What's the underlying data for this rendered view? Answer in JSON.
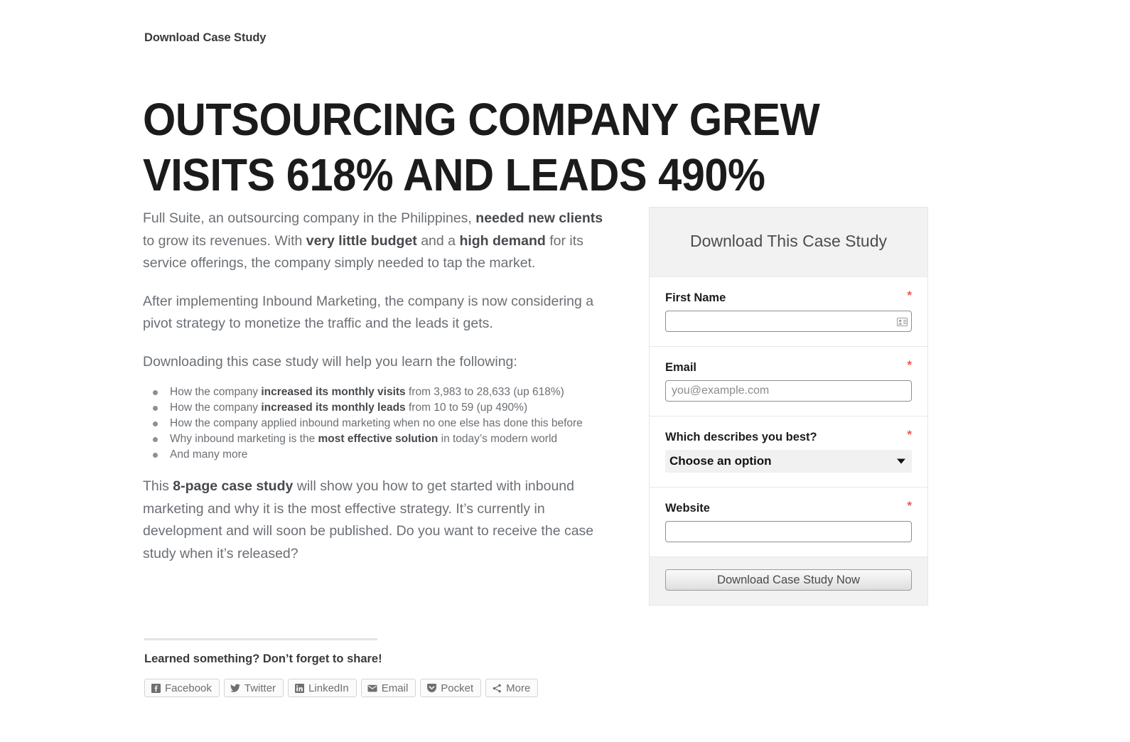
{
  "eyebrow": "Download Case Study",
  "headline": "OUTSOURCING COMPANY GREW VISITS 618% AND LEADS 490%",
  "article": {
    "paragraph1_a": "Full Suite, an outsourcing company in the Philippines, ",
    "paragraph1_b": "needed new clients",
    "paragraph1_c": " to grow its revenues. With ",
    "paragraph1_d": "very little budget",
    "paragraph1_e": " and a ",
    "paragraph1_f": "high demand",
    "paragraph1_g": " for its service offerings, the company simply needed to tap the market.",
    "paragraph2": "After implementing Inbound Marketing, the company is now considering a pivot strategy to monetize the traffic and the leads it gets.",
    "paragraph3": "Downloading this case study will help you learn the following:",
    "bullets": [
      {
        "pre": "How the company ",
        "bold": "increased its monthly visits",
        "post": " from 3,983 to 28,633 (up 618%)"
      },
      {
        "pre": "How the company ",
        "bold": "increased its monthly leads",
        "post": " from 10 to 59 (up 490%)"
      },
      {
        "pre": "How the company applied inbound marketing when no one else has done this before",
        "bold": "",
        "post": ""
      },
      {
        "pre": "Why inbound marketing is the ",
        "bold": "most effective solution",
        "post": " in today’s modern world"
      },
      {
        "pre": "And many more",
        "bold": "",
        "post": ""
      }
    ],
    "closing_a": "This ",
    "closing_b": "8-page case study",
    "closing_c": " will show you how to get started with inbound marketing and why it is the most effective strategy. It’s currently in development and will soon be published. Do you want to receive the case study when it’s released?"
  },
  "share": {
    "title": "Learned something? Don’t forget to share!",
    "buttons": [
      {
        "label": "Facebook",
        "icon": "facebook-icon"
      },
      {
        "label": "Twitter",
        "icon": "twitter-icon"
      },
      {
        "label": "LinkedIn",
        "icon": "linkedin-icon"
      },
      {
        "label": "Email",
        "icon": "envelope-icon"
      },
      {
        "label": "Pocket",
        "icon": "pocket-icon"
      },
      {
        "label": "More",
        "icon": "share-more-icon"
      }
    ]
  },
  "form": {
    "heading": "Download This Case Study",
    "required_mark": "*",
    "fields": [
      {
        "label": "First Name",
        "value": "",
        "placeholder": ""
      },
      {
        "label": "Email",
        "value": "",
        "placeholder": "you@example.com"
      },
      {
        "label": "Which describes you best?",
        "selected": "Choose an option"
      },
      {
        "label": "Website",
        "value": "",
        "placeholder": ""
      }
    ],
    "submit_label": "Download Case Study Now"
  },
  "colors": {
    "accent_required": "#f4574f",
    "panel_header_bg": "#f2f2f2",
    "body_text": "#6b6f74",
    "heading_text": "#1b1b1b"
  }
}
